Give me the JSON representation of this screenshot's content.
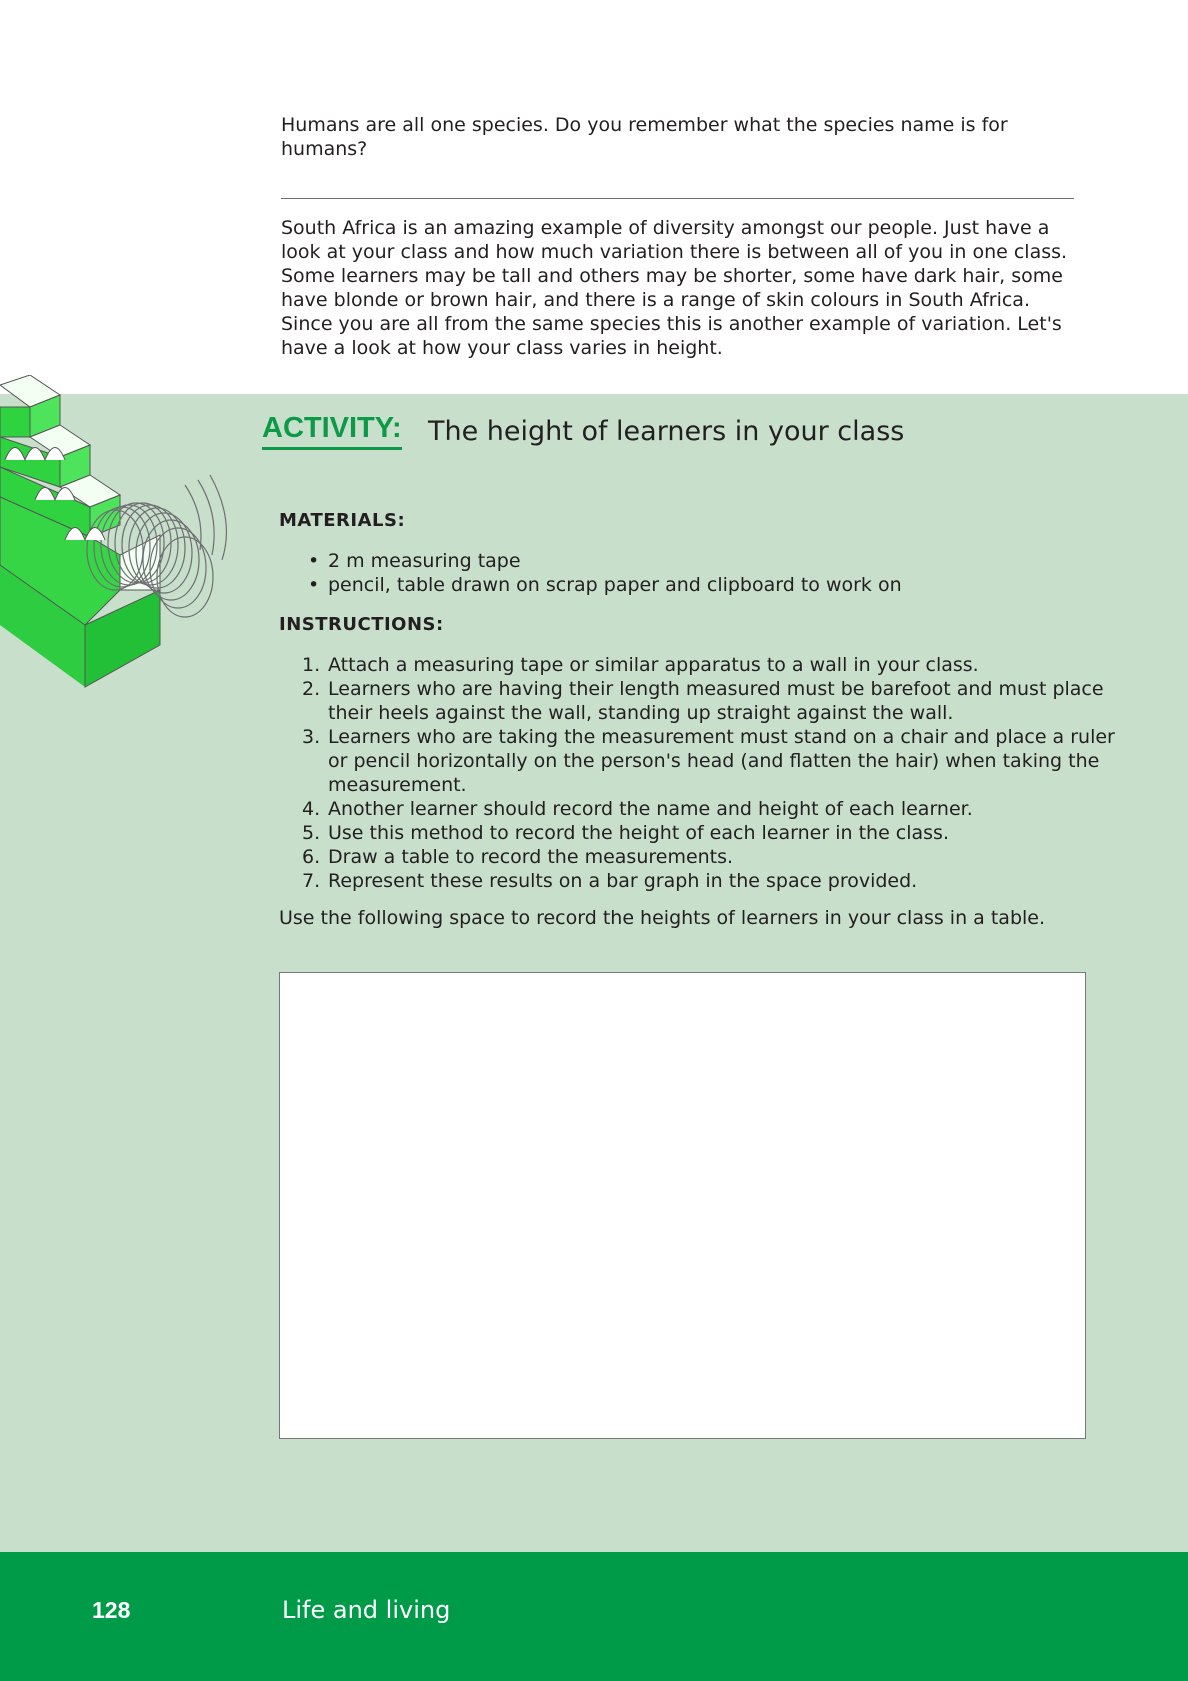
{
  "intro": {
    "question": "Humans are all one species. Do you remember what the species name is for humans?",
    "paragraph": "South Africa is an amazing example of diversity amongst our people. Just have a look at your class and how much variation there is between all of you in one class. Some learners may be tall and others may be shorter, some have dark hair, some have blonde or brown hair, and there is a range of skin colours in South Africa. Since you are all from the same species this is another example of variation. Let's have a look at how your class varies in height."
  },
  "activity": {
    "label": "ACTIVITY:",
    "title": "The height of learners in your class",
    "materials_heading": "MATERIALS:",
    "materials": [
      "2 m measuring tape",
      "pencil, table drawn on scrap paper and clipboard to work on"
    ],
    "instructions_heading": "INSTRUCTIONS:",
    "instructions": [
      "Attach a measuring tape or similar apparatus to a wall in your class.",
      "Learners who are having their length measured must be barefoot and must place their heels against the wall, standing up straight against the wall.",
      "Learners who are taking the measurement must stand on a chair and place a ruler or pencil horizontally on the person's head (and flatten the hair) when taking the measurement.",
      "Another learner should record the name and height of each learner.",
      "Use this method to record the height of each learner in the class.",
      "Draw a table to record the measurements.",
      "Represent these results on a bar graph in the space provided."
    ],
    "record_note": "Use the following space to record the heights of learners in your class in a table."
  },
  "footer": {
    "page_number": "128",
    "chapter": "Life and living"
  },
  "colors": {
    "accent_green": "#0c9a48",
    "panel_green": "#c8dfcb",
    "footer_green": "#009b48"
  }
}
